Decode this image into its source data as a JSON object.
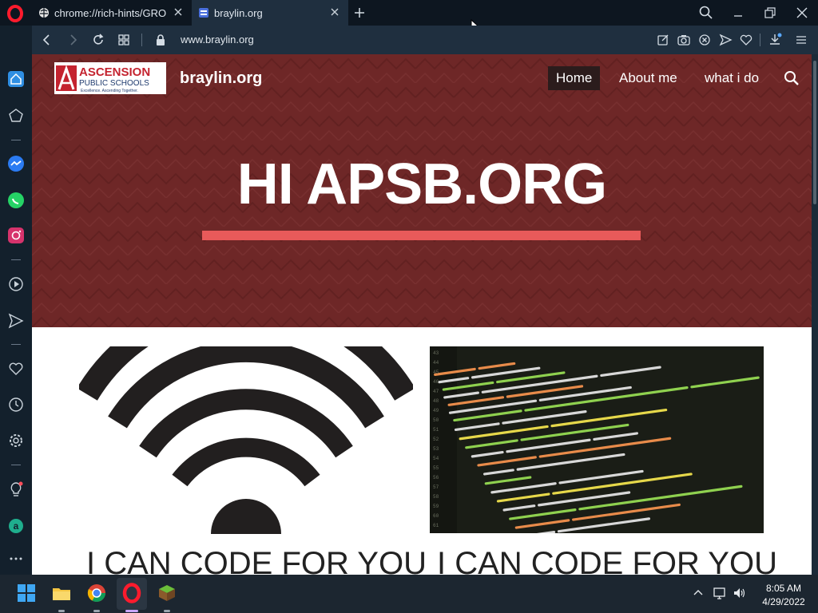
{
  "browser": {
    "tabs": [
      {
        "title": "chrome://rich-hints/GROW",
        "active": false
      },
      {
        "title": "braylin.org",
        "active": true
      }
    ],
    "address": {
      "url": "www.braylin.org"
    }
  },
  "site": {
    "logo": {
      "line1": "ASCENSION",
      "line2": "PUBLIC SCHOOLS",
      "tagline": "Excellence. Ascending Together."
    },
    "name": "braylin.org",
    "menu": [
      {
        "label": "Home",
        "active": true
      },
      {
        "label": "About me",
        "active": false
      },
      {
        "label": "what i do",
        "active": false
      }
    ],
    "hero_title": "HI APSB.ORG",
    "cards": [
      {
        "title": "I CAN CODE FOR YOU",
        "image": "wifi-icon"
      },
      {
        "title": "I CAN CODE FOR YOU",
        "image": "code-screenshot"
      }
    ]
  },
  "taskbar": {
    "time": "8:05 AM",
    "date": "4/29/2022"
  },
  "colors": {
    "hero_bg": "#6e2727",
    "accent_underline": "#e85a5a",
    "browser_chrome": "#1f2f3f"
  }
}
